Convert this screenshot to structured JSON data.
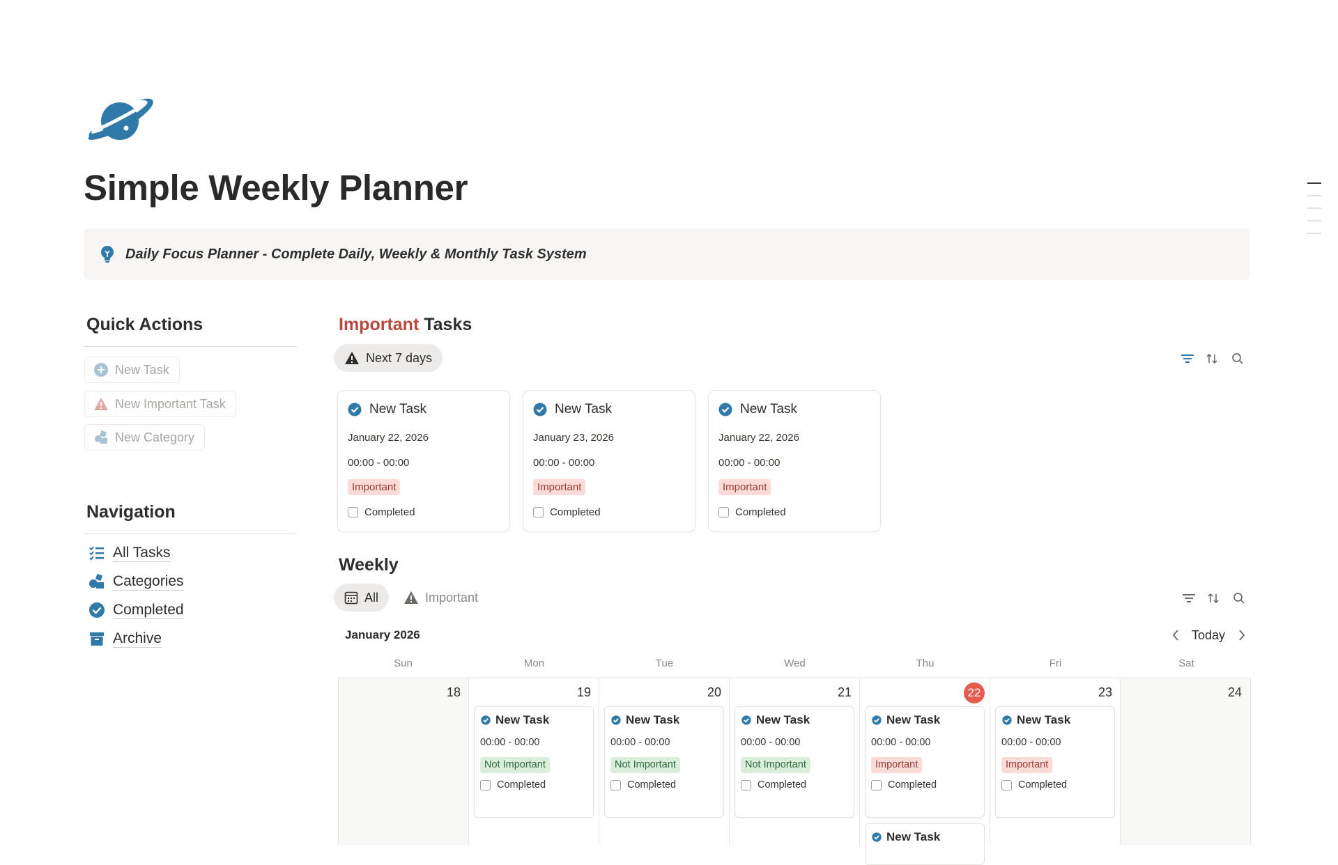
{
  "page": {
    "title": "Simple Weekly Planner",
    "callout": "Daily Focus Planner - Complete Daily, Weekly & Monthly Task System",
    "icon": "ringed-planet-icon",
    "accent_color": "#2f7aa8"
  },
  "quick_actions": {
    "heading": "Quick Actions",
    "buttons": [
      {
        "label": "New Task",
        "icon": "plus-circle-icon"
      },
      {
        "label": "New Important Task",
        "icon": "warning-icon"
      },
      {
        "label": "New Category",
        "icon": "shapes-icon"
      }
    ]
  },
  "navigation": {
    "heading": "Navigation",
    "items": [
      {
        "label": "All Tasks",
        "icon": "checklist-icon"
      },
      {
        "label": "Categories",
        "icon": "shapes-icon"
      },
      {
        "label": "Completed",
        "icon": "check-circle-icon"
      },
      {
        "label": "Archive",
        "icon": "archive-icon"
      }
    ]
  },
  "important": {
    "heading_accent": "Important",
    "heading_rest": " Tasks",
    "accent_color": "#b9493f",
    "view_tab": "Next 7 days",
    "cards": [
      {
        "title": "New Task",
        "date": "January 22, 2026",
        "time": "00:00 - 00:00",
        "tag": "Important",
        "checkbox": "Completed"
      },
      {
        "title": "New Task",
        "date": "January 23, 2026",
        "time": "00:00 - 00:00",
        "tag": "Important",
        "checkbox": "Completed"
      },
      {
        "title": "New Task",
        "date": "January 22, 2026",
        "time": "00:00 - 00:00",
        "tag": "Important",
        "checkbox": "Completed"
      }
    ]
  },
  "weekly": {
    "heading": "Weekly",
    "tabs": [
      {
        "label": "All",
        "icon": "calendar-icon",
        "active": true
      },
      {
        "label": "Important",
        "icon": "warning-icon",
        "active": false
      }
    ],
    "month": "January 2026",
    "today_label": "Today",
    "weekdays": [
      "Sun",
      "Mon",
      "Tue",
      "Wed",
      "Thu",
      "Fri",
      "Sat"
    ],
    "days": [
      {
        "num": "18",
        "weekend": true,
        "today": false,
        "task": null
      },
      {
        "num": "19",
        "weekend": false,
        "today": false,
        "task": {
          "title": "New Task",
          "time": "00:00 - 00:00",
          "tag": "Not Important",
          "checkbox": "Completed"
        }
      },
      {
        "num": "20",
        "weekend": false,
        "today": false,
        "task": {
          "title": "New Task",
          "time": "00:00 - 00:00",
          "tag": "Not Important",
          "checkbox": "Completed"
        }
      },
      {
        "num": "21",
        "weekend": false,
        "today": false,
        "task": {
          "title": "New Task",
          "time": "00:00 - 00:00",
          "tag": "Not Important",
          "checkbox": "Completed"
        }
      },
      {
        "num": "22",
        "weekend": false,
        "today": true,
        "task": {
          "title": "New Task",
          "time": "00:00 - 00:00",
          "tag": "Important",
          "checkbox": "Completed"
        },
        "extra_task": "New Task"
      },
      {
        "num": "23",
        "weekend": false,
        "today": false,
        "task": {
          "title": "New Task",
          "time": "00:00 - 00:00",
          "tag": "Important",
          "checkbox": "Completed"
        }
      },
      {
        "num": "24",
        "weekend": true,
        "today": false,
        "task": null
      }
    ]
  }
}
